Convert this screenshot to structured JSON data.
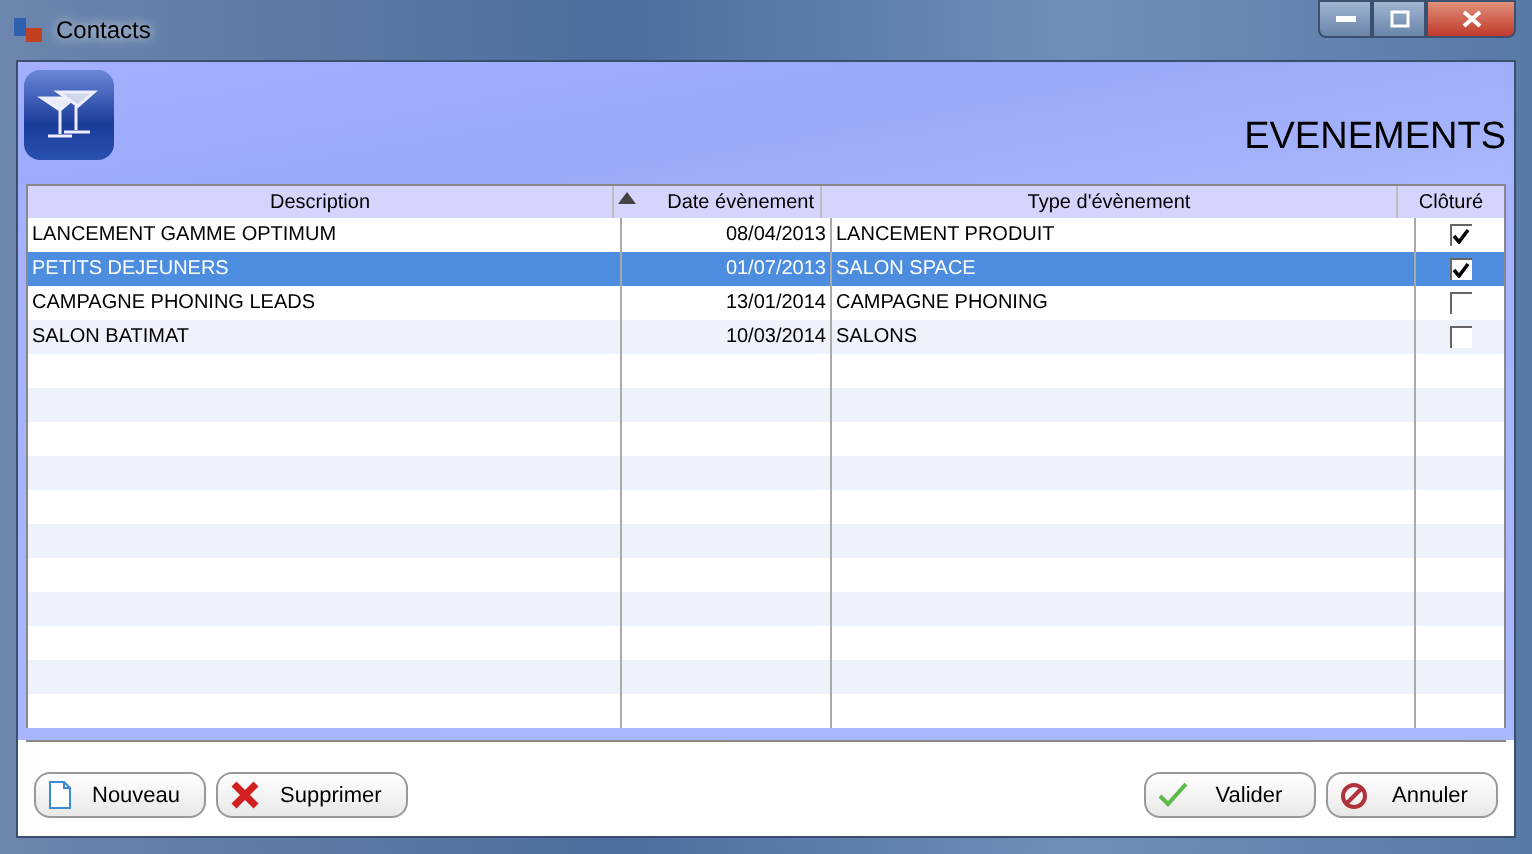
{
  "window": {
    "title": "Contacts"
  },
  "header": {
    "title": "EVENEMENTS"
  },
  "table": {
    "columns": [
      {
        "label": "Description",
        "sorted": false
      },
      {
        "label": "Date évènement",
        "sorted": true
      },
      {
        "label": "Type d'évènement",
        "sorted": false
      },
      {
        "label": "Clôturé",
        "sorted": false
      }
    ],
    "rows": [
      {
        "description": "LANCEMENT GAMME OPTIMUM",
        "date": "08/04/2013",
        "type": "LANCEMENT PRODUIT",
        "checked": true,
        "selected": false
      },
      {
        "description": "PETITS DEJEUNERS",
        "date": "01/07/2013",
        "type": "SALON SPACE",
        "checked": true,
        "selected": true
      },
      {
        "description": "CAMPAGNE PHONING LEADS",
        "date": "13/01/2014",
        "type": "CAMPAGNE PHONING",
        "checked": false,
        "selected": false
      },
      {
        "description": "SALON BATIMAT",
        "date": "10/03/2014",
        "type": "SALONS",
        "checked": false,
        "selected": false
      }
    ]
  },
  "buttons_left": [
    {
      "label": "Nouveau",
      "kind": "new"
    },
    {
      "label": "Supprimer",
      "kind": "delete"
    }
  ],
  "buttons_right": [
    {
      "label": "Valider",
      "kind": "ok"
    },
    {
      "label": "Annuler",
      "kind": "cancel"
    }
  ]
}
